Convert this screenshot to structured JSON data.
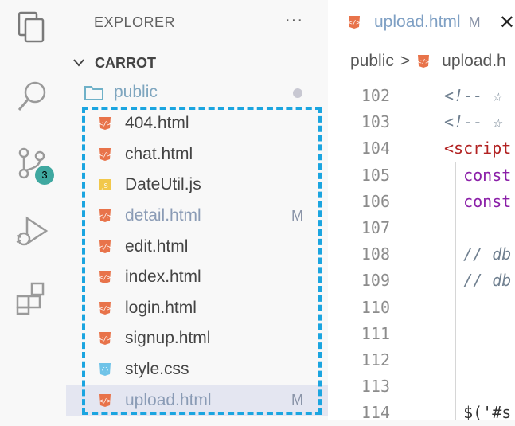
{
  "activity": {
    "badge_count": "3"
  },
  "sidebar": {
    "title": "EXPLORER",
    "more": "···",
    "project": "CARROT",
    "folder": "public",
    "files": [
      {
        "name": "404.html",
        "type": "html",
        "status": ""
      },
      {
        "name": "chat.html",
        "type": "html",
        "status": ""
      },
      {
        "name": "DateUtil.js",
        "type": "js",
        "status": ""
      },
      {
        "name": "detail.html",
        "type": "html",
        "status": "M"
      },
      {
        "name": "edit.html",
        "type": "html",
        "status": ""
      },
      {
        "name": "index.html",
        "type": "html",
        "status": ""
      },
      {
        "name": "login.html",
        "type": "html",
        "status": ""
      },
      {
        "name": "signup.html",
        "type": "html",
        "status": ""
      },
      {
        "name": "style.css",
        "type": "css",
        "status": ""
      },
      {
        "name": "upload.html",
        "type": "html",
        "status": "M"
      }
    ]
  },
  "editor": {
    "tab": {
      "name": "upload.html",
      "status": "M"
    },
    "breadcrumb": {
      "folder": "public",
      "sep": ">",
      "file": "upload.h"
    },
    "line_numbers": [
      "102",
      "103",
      "104",
      "105",
      "106",
      "107",
      "108",
      "109",
      "110",
      "111",
      "112",
      "113",
      "114"
    ],
    "code": [
      {
        "text": "<!-- ☆",
        "cls": "comment"
      },
      {
        "text": "<!-- ☆",
        "cls": "comment"
      },
      {
        "text": "<script",
        "cls": "tag"
      },
      {
        "text": "  const",
        "cls": "kw"
      },
      {
        "text": "  const",
        "cls": "kw"
      },
      {
        "text": "",
        "cls": "plain"
      },
      {
        "text": "  // db",
        "cls": "comment"
      },
      {
        "text": "  // db",
        "cls": "comment"
      },
      {
        "text": "",
        "cls": "plain"
      },
      {
        "text": "",
        "cls": "plain"
      },
      {
        "text": "",
        "cls": "plain"
      },
      {
        "text": "",
        "cls": "plain"
      },
      {
        "text": "  $('#s",
        "cls": "plain"
      }
    ]
  },
  "colors": {
    "html_icon": "#e8734a",
    "js_icon": "#f2c84b",
    "css_icon": "#6fc3e8",
    "highlight_border": "#1ba5e0"
  }
}
